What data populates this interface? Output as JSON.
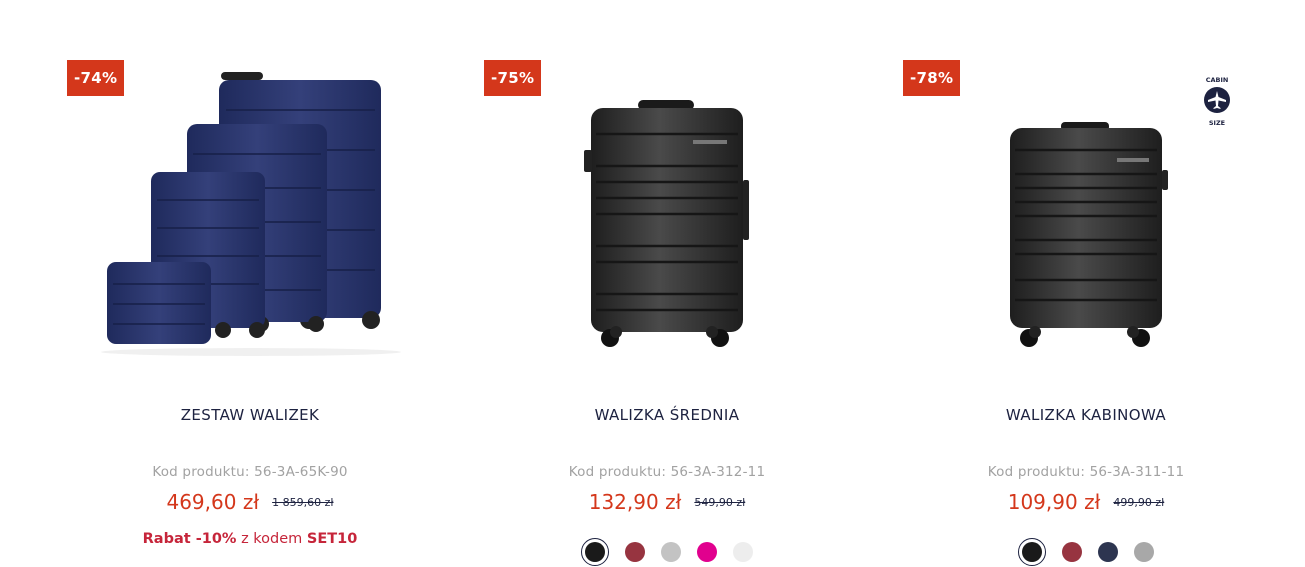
{
  "products": [
    {
      "discount": "-74%",
      "title": "ZESTAW WALIZEK",
      "code": "Kod produktu: 56-3A-65K-90",
      "price": "469,60 zł",
      "old_price": "1 859,60 zł",
      "promo": {
        "prefix": "Rabat -10%",
        "middle": " z kodem ",
        "code": "SET10"
      },
      "image_icon": "navy-suitcase-set-image",
      "body_color": "#28336a"
    },
    {
      "discount": "-75%",
      "title": "WALIZKA ŚREDNIA",
      "code": "Kod produktu: 56-3A-312-11",
      "price": "132,90 zł",
      "old_price": "549,90 zł",
      "image_icon": "black-medium-suitcase-image",
      "body_color": "#2e2e2e",
      "swatches": [
        {
          "color": "#1a1a1a",
          "selected": true
        },
        {
          "color": "#973440",
          "selected": false
        },
        {
          "color": "#c3c3c3",
          "selected": false
        },
        {
          "color": "#e1008e",
          "selected": false
        },
        {
          "color": "#ededed",
          "selected": false
        }
      ]
    },
    {
      "discount": "-78%",
      "title": "WALIZKA KABINOWA",
      "code": "Kod produktu: 56-3A-311-11",
      "price": "109,90 zł",
      "old_price": "499,90 zł",
      "image_icon": "black-cabin-suitcase-image",
      "body_color": "#2e2e2e",
      "cabin_badge": {
        "top": "CABIN",
        "bottom": "SIZE",
        "icon": "airplane-icon"
      },
      "swatches": [
        {
          "color": "#1a1a1a",
          "selected": true
        },
        {
          "color": "#973440",
          "selected": false
        },
        {
          "color": "#2d3550",
          "selected": false
        },
        {
          "color": "#a8a8a8",
          "selected": false
        }
      ]
    }
  ],
  "colors": {
    "accent": "#d4371b",
    "promo": "#c6253a",
    "text": "#1d2240",
    "muted": "#a2a2a2"
  }
}
